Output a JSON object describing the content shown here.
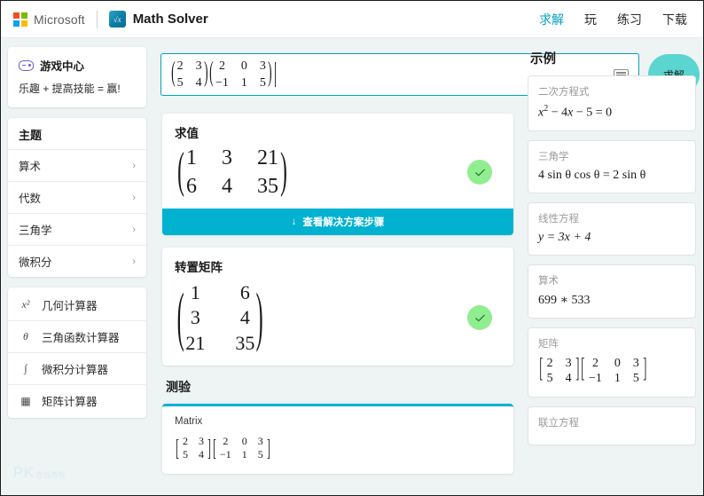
{
  "topbar": {
    "brand": "Microsoft",
    "app_name": "Math Solver",
    "app_icon": "math-solver-icon",
    "nav": [
      {
        "label": "求解",
        "active": true
      },
      {
        "label": "玩",
        "active": false
      },
      {
        "label": "练习",
        "active": false
      },
      {
        "label": "下载",
        "active": false
      }
    ]
  },
  "sidebar": {
    "game_center": {
      "icon": "gamepad-icon",
      "title": "游戏中心",
      "subtitle": "乐趣 + 提高技能 = 赢!"
    },
    "topics_title": "主题",
    "topics": [
      {
        "label": "算术",
        "chevron": "›"
      },
      {
        "label": "代数",
        "chevron": "›"
      },
      {
        "label": "三角学",
        "chevron": "›"
      },
      {
        "label": "微积分",
        "chevron": "›"
      }
    ],
    "calculators": [
      {
        "icon": "x-squared-icon",
        "glyph": "x²",
        "label": "几何计算器"
      },
      {
        "icon": "theta-icon",
        "glyph": "θ",
        "label": "三角函数计算器"
      },
      {
        "icon": "integral-icon",
        "glyph": "∫",
        "label": "微积分计算器"
      },
      {
        "icon": "matrix-grid-icon",
        "glyph": "▦",
        "label": "矩阵计算器"
      }
    ],
    "watermark": {
      "text": "PK",
      "sub": "在线教程"
    }
  },
  "input": {
    "expression_label": "matrix-multiplication-input",
    "matrix_a": {
      "rows": [
        [
          "2",
          "3"
        ],
        [
          "5",
          "4"
        ]
      ]
    },
    "matrix_b": {
      "rows": [
        [
          "2",
          "0",
          "3"
        ],
        [
          "-1",
          "1",
          "5"
        ]
      ]
    },
    "keyboard_icon": "keyboard-icon",
    "solve_label": "求解"
  },
  "results": [
    {
      "title": "求值",
      "matrix": {
        "rows": [
          [
            "1",
            "3",
            "21"
          ],
          [
            "6",
            "4",
            "35"
          ]
        ]
      },
      "status_icon": "check-icon",
      "steps_label": "查看解决方案步骤",
      "steps_arrow": "↓",
      "has_steps_bar": true
    },
    {
      "title": "转置矩阵",
      "matrix": {
        "rows": [
          [
            "1",
            "6"
          ],
          [
            "3",
            "4"
          ],
          [
            "21",
            "35"
          ]
        ]
      },
      "status_icon": "check-icon",
      "steps_label": "",
      "steps_arrow": "",
      "has_steps_bar": false
    }
  ],
  "quiz": {
    "title": "测验",
    "card_label": "Matrix",
    "matrix_a": {
      "rows": [
        [
          "2",
          "3"
        ],
        [
          "5",
          "4"
        ]
      ]
    },
    "matrix_b": {
      "rows": [
        [
          "2",
          "0",
          "3"
        ],
        [
          "-1",
          "1",
          "5"
        ]
      ]
    }
  },
  "examples": {
    "title": "示例",
    "items": [
      {
        "label": "二次方程式",
        "math": "x² − 4x − 5 = 0",
        "kind": "text"
      },
      {
        "label": "三角学",
        "math": "4 sin θ cos θ = 2 sin θ",
        "kind": "text"
      },
      {
        "label": "线性方程",
        "math": "y = 3x + 4",
        "kind": "text"
      },
      {
        "label": "算术",
        "math": "699 ∗ 533",
        "kind": "text"
      },
      {
        "label": "矩阵",
        "math": "",
        "kind": "matrix",
        "matrix_a": {
          "rows": [
            [
              "2",
              "3"
            ],
            [
              "5",
              "4"
            ]
          ]
        },
        "matrix_b": {
          "rows": [
            [
              "2",
              "0",
              "3"
            ],
            [
              "-1",
              "1",
              "5"
            ]
          ]
        }
      },
      {
        "label": "联立方程",
        "math": "",
        "kind": "text"
      }
    ]
  },
  "colors": {
    "accent": "#00a2bd",
    "solve_button": "#5ad5d0",
    "steps_bar": "#00b2d0",
    "check_badge": "#90ee90",
    "page_bg": "#eef3f4"
  }
}
